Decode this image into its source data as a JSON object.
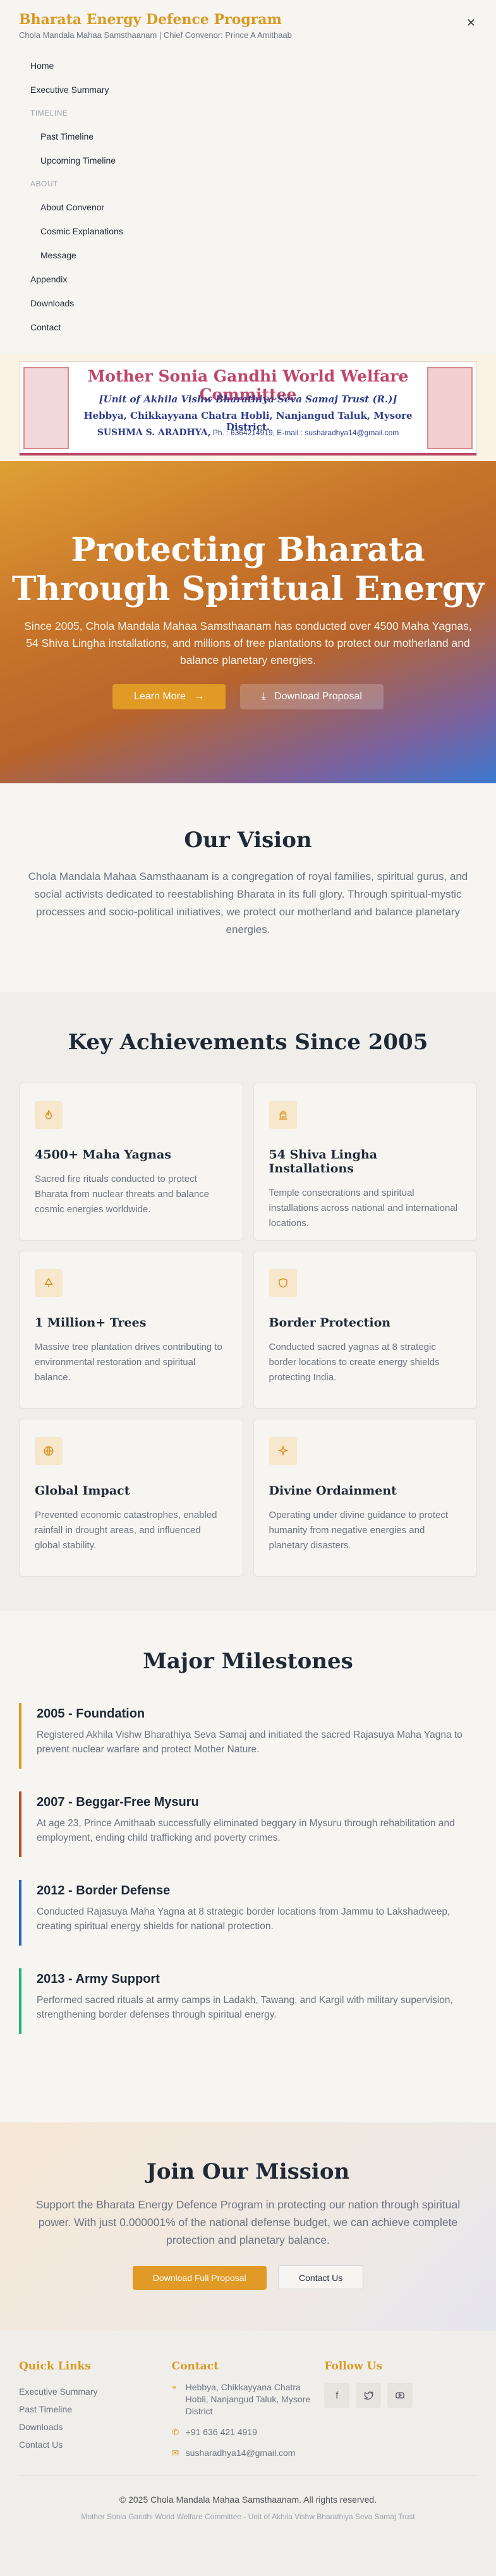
{
  "header": {
    "brand": "Bharata Energy Defence Program",
    "subtitle": "Chola Mandala Mahaa Samsthaanam | Chief Convenor: Prince A Amithaab",
    "close_icon": "close-icon"
  },
  "menu": {
    "home": "Home",
    "executive_summary": "Executive Summary",
    "timeline_label": "TIMELINE",
    "past_timeline": "Past Timeline",
    "upcoming_timeline": "Upcoming Timeline",
    "about_label": "ABOUT",
    "about_convenor": "About Convenor",
    "cosmic_explanations": "Cosmic Explanations",
    "message": "Message",
    "appendix": "Appendix",
    "downloads": "Downloads",
    "contact": "Contact"
  },
  "banner": {
    "title": "Mother Sonia Gandhi World Welfare Committee",
    "line2": "[Unit of Akhila Vishw Bharathiya Seva Samaj Trust (R.)]",
    "line3": "Hebbya, Chikkayyana Chatra Hobli, Nanjangud Taluk, Mysore District.",
    "name": "SUSHMA S. ARADHYA,",
    "contact": "Ph. : 6364214919, E-mail : susharadhya14@gmail.com"
  },
  "hero": {
    "title_line1": "Protecting Bharata",
    "title_line2": "Through Spiritual Energy",
    "text": "Since 2005, Chola Mandala Mahaa Samsthaanam has conducted over 4500 Maha Yagnas, 54 Shiva Lingha installations, and millions of tree plantations to protect our motherland and balance planetary energies.",
    "learn_more": "Learn More",
    "download_proposal": "Download Proposal"
  },
  "vision": {
    "title": "Our Vision",
    "text": "Chola Mandala Mahaa Samsthaanam is a congregation of royal families, spiritual gurus, and social activists dedicated to reestablishing Bharata in its full glory. Through spiritual-mystic processes and socio-political initiatives, we protect our motherland and balance planetary energies."
  },
  "achievements": {
    "title": "Key Achievements Since 2005",
    "cards": [
      {
        "icon": "flame-icon",
        "title": "4500+ Maha Yagnas",
        "text": "Sacred fire rituals conducted to protect Bharata from nuclear threats and balance cosmic energies worldwide."
      },
      {
        "icon": "temple-icon",
        "title": "54 Shiva Lingha Installations",
        "text": "Temple consecrations and spiritual installations across national and international locations."
      },
      {
        "icon": "tree-icon",
        "title": "1 Million+ Trees",
        "text": "Massive tree plantation drives contributing to environmental restoration and spiritual balance."
      },
      {
        "icon": "shield-icon",
        "title": "Border Protection",
        "text": "Conducted sacred yagnas at 8 strategic border locations to create energy shields protecting India."
      },
      {
        "icon": "globe-icon",
        "title": "Global Impact",
        "text": "Prevented economic catastrophes, enabled rainfall in drought areas, and influenced global stability."
      },
      {
        "icon": "sparkle-icon",
        "title": "Divine Ordainment",
        "text": "Operating under divine guidance to protect humanity from negative energies and planetary disasters."
      }
    ]
  },
  "milestones": {
    "title": "Major Milestones",
    "items": [
      {
        "title": "2005 - Foundation",
        "text": "Registered Akhila Vishw Bharathiya Seva Samaj and initiated the sacred Rajasuya Maha Yagna to prevent nuclear warfare and protect Mother Nature.",
        "color": "#e09a25"
      },
      {
        "title": "2007 - Beggar-Free Mysuru",
        "text": "At age 23, Prince Amithaab successfully eliminated beggary in Mysuru through rehabilitation and employment, ending child trafficking and poverty crimes.",
        "color": "#b4531f"
      },
      {
        "title": "2012 - Border Defense",
        "text": "Conducted Rajasuya Maha Yagna at 8 strategic border locations from Jammu to Lakshadweep, creating spiritual energy shields for national protection.",
        "color": "#2d62c9"
      },
      {
        "title": "2013 - Army Support",
        "text": "Performed sacred rituals at army camps in Ladakh, Tawang, and Kargil with military supervision, strengthening border defenses through spiritual energy.",
        "color": "#22b573"
      }
    ]
  },
  "join": {
    "title": "Join Our Mission",
    "text": "Support the Bharata Energy Defence Program in protecting our nation through spiritual power. With just 0.000001% of the national defense budget, we can achieve complete protection and planetary balance.",
    "download_full": "Download Full Proposal",
    "contact_us": "Contact Us"
  },
  "footer": {
    "quick_links_title": "Quick Links",
    "quick_links": [
      "Executive Summary",
      "Past Timeline",
      "Downloads",
      "Contact Us"
    ],
    "contact_title": "Contact",
    "address": "Hebbya, Chikkayyana Chatra Hobli, Nanjangud Taluk, Mysore District",
    "phone": "+91 636 421 4919",
    "email": "susharadhya14@gmail.com",
    "follow_title": "Follow Us",
    "social_icons": [
      "facebook-icon",
      "twitter-icon",
      "youtube-icon"
    ],
    "copyright": "© 2025 Chola Mandala Mahaa Samsthaanam. All rights reserved.",
    "unit_line": "Mother Sonia Gandhi World Welfare Committee - Unit of Akhila Vishw Bharathiya Seva Samaj Trust"
  },
  "colors": {
    "accent": "#e09a25",
    "brand_text": "#d99a22",
    "hero_start": "#e0a035",
    "hero_end": "#3c78cf"
  }
}
